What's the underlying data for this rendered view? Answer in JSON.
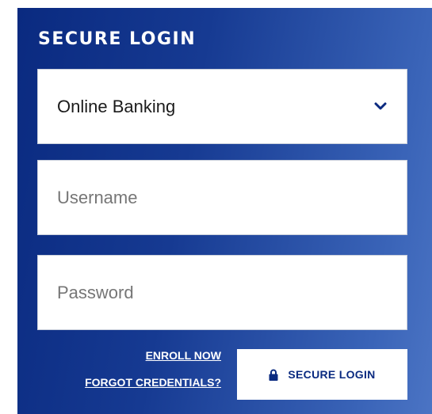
{
  "login": {
    "title": "SECURE LOGIN",
    "account_type": {
      "selected": "Online Banking",
      "icon": "chevron-down-icon"
    },
    "username": {
      "placeholder": "Username"
    },
    "password": {
      "placeholder": "Password"
    },
    "links": {
      "enroll": "ENROLL NOW",
      "forgot": "FORGOT CREDENTIALS?"
    },
    "submit": {
      "label": "SECURE LOGIN",
      "icon": "lock-icon"
    }
  },
  "colors": {
    "panel_start": "#0a2a80",
    "panel_end": "#4b74c4",
    "accent": "#0a2a80",
    "field_bg": "#ffffff",
    "placeholder": "#767676"
  }
}
